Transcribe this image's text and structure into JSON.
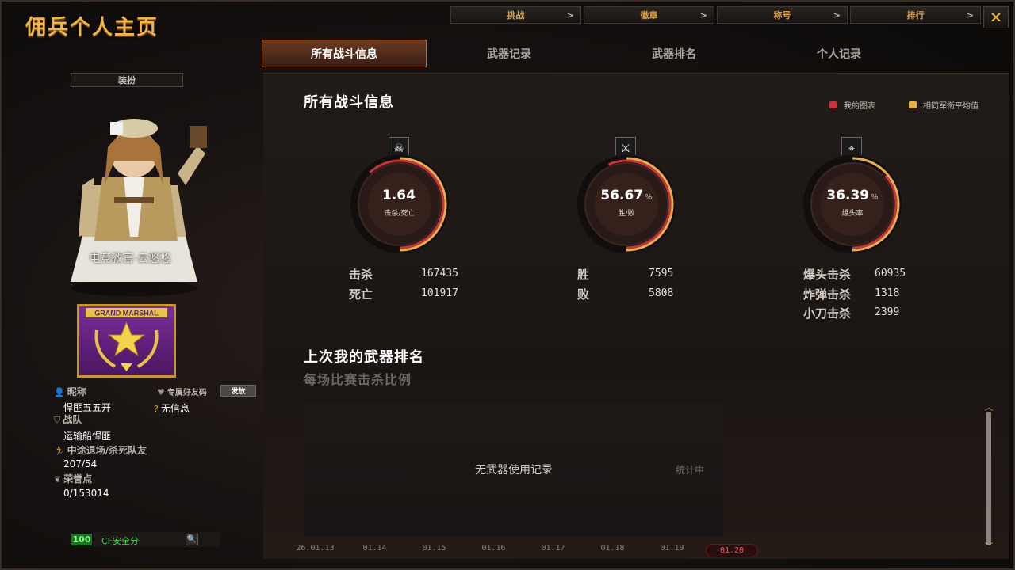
{
  "window": {
    "title": "佣兵个人主页",
    "close_glyph": "✕"
  },
  "top_nav": [
    {
      "label": "挑战",
      "chev": ">"
    },
    {
      "label": "徽章",
      "chev": ">"
    },
    {
      "label": "称号",
      "chev": ">"
    },
    {
      "label": "排行",
      "chev": ">"
    }
  ],
  "tabs": [
    {
      "label": "所有战斗信息",
      "active": true
    },
    {
      "label": "武器记录",
      "active": false
    },
    {
      "label": "武器排名",
      "active": false
    },
    {
      "label": "个人记录",
      "active": false
    }
  ],
  "profile": {
    "equip_button": "装扮",
    "character_name": "电竞教官-云悠悠",
    "rank_badge_text": "GRAND MARSHAL",
    "nickname_label": "昵称",
    "nickname": "悍匪五五开",
    "friend_code_label": "专属好友码",
    "send_button": "发放",
    "no_info": "无信息",
    "team_label": "战队",
    "team": "运输船悍匪",
    "quit_label": "中途退场/杀死队友",
    "quit_value": "207/54",
    "honor_label": "荣誉点",
    "honor_value": "0/153014",
    "security_score": "100",
    "security_label": "CF安全分",
    "search_icon": "🔍"
  },
  "main": {
    "title": "所有战斗信息",
    "legend": [
      {
        "label": "我的图表",
        "color": "#c8343b"
      },
      {
        "label": "相同军衔平均值",
        "color": "#e6b04a"
      }
    ],
    "gauges": [
      {
        "value": "1.64",
        "suffix": "",
        "label": "击杀/死亡",
        "icon": "☠",
        "fraction": 0.62
      },
      {
        "value": "56.67",
        "suffix": "%",
        "label": "胜/败",
        "icon": "⚔",
        "fraction": 0.5667
      },
      {
        "value": "36.39",
        "suffix": "%",
        "label": "爆头率",
        "icon": "⌖",
        "fraction": 0.3639
      }
    ],
    "stats": {
      "kills_label": "击杀",
      "kills": "167435",
      "deaths_label": "死亡",
      "deaths": "101917",
      "wins_label": "胜",
      "wins": "7595",
      "losses_label": "败",
      "losses": "5808",
      "headshot_label": "爆头击杀",
      "headshot": "60935",
      "bomb_label": "炸弹击杀",
      "bomb": "1318",
      "knife_label": "小刀击杀",
      "knife": "2399"
    },
    "weapon_title": "上次我的武器排名",
    "weapon_sub": "每场比赛击杀比例",
    "weapon_empty": "无武器使用记录",
    "stat_calc": "统计中",
    "dates": [
      "26.01.13",
      "01.14",
      "01.15",
      "01.16",
      "01.17",
      "01.18",
      "01.19",
      "01.20"
    ],
    "active_date": "01.20"
  }
}
